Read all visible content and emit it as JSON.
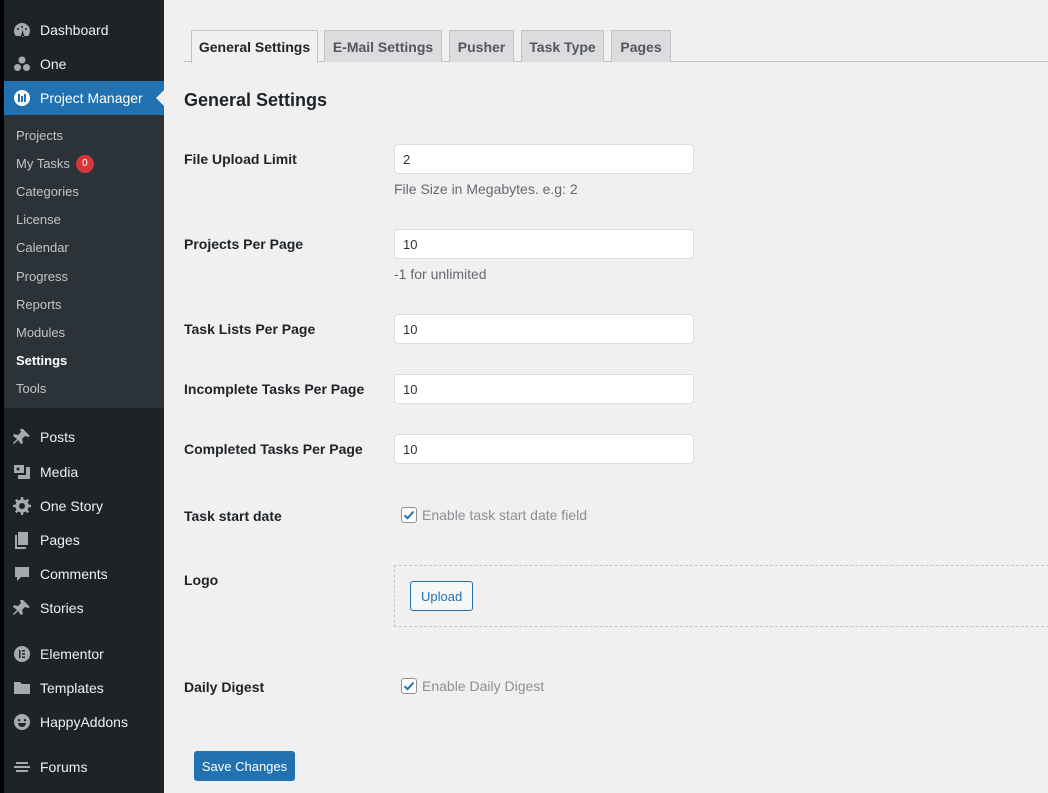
{
  "sidebar": {
    "top_items": [
      {
        "label": "Dashboard",
        "icon": "dashboard-icon"
      },
      {
        "label": "One",
        "icon": "one-icon"
      },
      {
        "label": "Project Manager",
        "icon": "project-manager-icon"
      }
    ],
    "submenu": [
      {
        "label": "Projects"
      },
      {
        "label": "My Tasks",
        "badge": "0"
      },
      {
        "label": "Categories"
      },
      {
        "label": "License"
      },
      {
        "label": "Calendar"
      },
      {
        "label": "Progress"
      },
      {
        "label": "Reports"
      },
      {
        "label": "Modules"
      },
      {
        "label": "Settings"
      },
      {
        "label": "Tools"
      }
    ],
    "bottom_items": [
      {
        "label": "Posts",
        "icon": "pin-icon"
      },
      {
        "label": "Media",
        "icon": "media-icon"
      },
      {
        "label": "One Story",
        "icon": "gear-icon"
      },
      {
        "label": "Pages",
        "icon": "pages-icon"
      },
      {
        "label": "Comments",
        "icon": "comment-icon"
      },
      {
        "label": "Stories",
        "icon": "pin-icon"
      },
      {
        "label": "Elementor",
        "icon": "elementor-icon"
      },
      {
        "label": "Templates",
        "icon": "folder-icon"
      },
      {
        "label": "HappyAddons",
        "icon": "happy-icon"
      },
      {
        "label": "Forums",
        "icon": "forums-icon"
      }
    ]
  },
  "tabs": [
    {
      "label": "General Settings",
      "active": true
    },
    {
      "label": "E-Mail Settings"
    },
    {
      "label": "Pusher"
    },
    {
      "label": "Task Type"
    },
    {
      "label": "Pages"
    }
  ],
  "page_title": "General Settings",
  "fields": {
    "file_upload_limit": {
      "label": "File Upload Limit",
      "value": "2",
      "description": "File Size in Megabytes. e.g: 2"
    },
    "projects_per_page": {
      "label": "Projects Per Page",
      "value": "10",
      "description": "-1 for unlimited"
    },
    "task_lists_per_page": {
      "label": "Task Lists Per Page",
      "value": "10"
    },
    "incomplete_tasks_per_page": {
      "label": "Incomplete Tasks Per Page",
      "value": "10"
    },
    "completed_tasks_per_page": {
      "label": "Completed Tasks Per Page",
      "value": "10"
    },
    "task_start_date": {
      "label": "Task start date",
      "checkbox_label": "Enable task start date field",
      "checked": true
    },
    "logo": {
      "label": "Logo",
      "button": "Upload"
    },
    "daily_digest": {
      "label": "Daily Digest",
      "checkbox_label": "Enable Daily Digest",
      "checked": true
    }
  },
  "save_button": "Save Changes",
  "colors": {
    "sidebar_bg": "#1d2327",
    "submenu_bg": "#2c3338",
    "accent": "#2271b1",
    "badge": "#d63638",
    "page_bg": "#f0f0f1"
  }
}
